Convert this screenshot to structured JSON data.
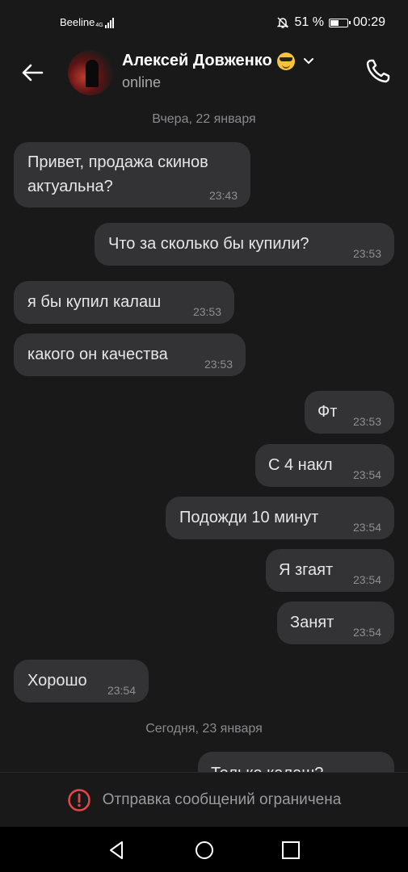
{
  "status": {
    "carrier": "Beeline",
    "network": "4G",
    "battery": "51 %",
    "battery_level": 0.51,
    "time": "00:29"
  },
  "header": {
    "name": "Алексей Довженко",
    "status": "online"
  },
  "chat": {
    "date_yesterday": "Вчера, 22 января",
    "date_today": "Сегодня, 23 января",
    "messages": [
      {
        "text": "Привет, продажа скинов\nактуальна?",
        "time": "23:43",
        "side": "in"
      },
      {
        "text": "Что за сколько бы купили?",
        "time": "23:53",
        "side": "out"
      },
      {
        "text": "я бы купил калаш",
        "time": "23:53",
        "side": "in"
      },
      {
        "text": "какого он качества",
        "time": "23:53",
        "side": "in"
      },
      {
        "text": "Фт",
        "time": "23:53",
        "side": "out"
      },
      {
        "text": "С 4 накл",
        "time": "23:54",
        "side": "out"
      },
      {
        "text": "Подожди 10 минут",
        "time": "23:54",
        "side": "out"
      },
      {
        "text": "Я згаят",
        "time": "23:54",
        "side": "out"
      },
      {
        "text": "Занят",
        "time": "23:54",
        "side": "out"
      },
      {
        "text": "Хорошо",
        "time": "23:54",
        "side": "in"
      },
      {
        "text": "Только калаш?",
        "time": "",
        "side": "out"
      }
    ]
  },
  "bottom": {
    "restricted_text": "Отправка сообщений ограничена"
  },
  "colors": {
    "background": "#19191a",
    "bubble": "#333335",
    "warning": "#e64646"
  }
}
